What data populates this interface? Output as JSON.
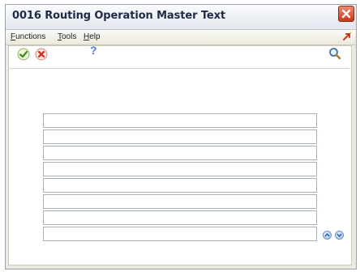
{
  "window": {
    "title": "0016  Routing Operation Master Text"
  },
  "menu": {
    "functions": "Functions",
    "tools": "Tools",
    "help": "Help"
  },
  "toolbar": {
    "help_glyph": "?",
    "icons": [
      "ok-check-icon",
      "cancel-x-icon",
      "help-icon",
      "search-icon",
      "exit-icon"
    ]
  },
  "text_lines": {
    "count": 8,
    "values": [
      "",
      "",
      "",
      "",
      "",
      "",
      "",
      ""
    ]
  },
  "colors": {
    "title_text": "#1f2a44",
    "window_bg": "#ece9df",
    "field_border": "#a9b1bd",
    "close_button": "#d9472b"
  }
}
